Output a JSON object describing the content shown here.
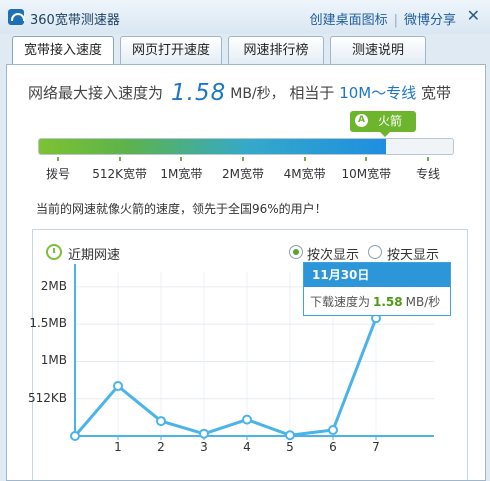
{
  "window": {
    "title": "360宽带测速器",
    "links": [
      "创建桌面图标",
      "微博分享"
    ]
  },
  "tabs": [
    {
      "label": "宽带接入速度",
      "active": true
    },
    {
      "label": "网页打开速度",
      "active": false
    },
    {
      "label": "网速排行榜",
      "active": false
    },
    {
      "label": "测速说明",
      "active": false
    }
  ],
  "result": {
    "prefix": "网络最大接入速度为",
    "speed": "1.58",
    "unit": "MB/秒，",
    "equiv_prefix": "相当于",
    "equiv_value": "10M～专线",
    "equiv_suffix": "宽带"
  },
  "meter": {
    "badge_label": "火箭",
    "badge_icon": "pin-icon",
    "fill_fraction": 0.838,
    "tick_labels": [
      "拨号",
      "512K宽带",
      "1M宽带",
      "2M宽带",
      "4M宽带",
      "10M宽带",
      "专线"
    ],
    "bar_colors": [
      "#7dc232",
      "#1f8ee0"
    ]
  },
  "description": "当前的网速就像火箭的速度，领先于全国96%的用户！",
  "recent": {
    "title": "近期网速",
    "radio_options": [
      {
        "label": "按次显示",
        "selected": true
      },
      {
        "label": "按天显示",
        "selected": false
      }
    ],
    "tooltip": {
      "date": "11月30日",
      "label": "下载速度为",
      "value": "1.58",
      "unit": "MB/秒"
    }
  },
  "chart_data": {
    "type": "line",
    "x": [
      0,
      1,
      2,
      3,
      4,
      5,
      6,
      7
    ],
    "x_tick_labels": [
      "1",
      "2",
      "3",
      "4",
      "5",
      "6",
      "7"
    ],
    "y_tick_labels": [
      "2MB",
      "1.5MB",
      "1MB",
      "512KB"
    ],
    "y_tick_values": [
      2,
      1.5,
      1,
      0.5
    ],
    "values": [
      0,
      0.67,
      0.2,
      0.03,
      0.22,
      0.01,
      0.08,
      1.58
    ],
    "ylim": [
      0,
      2.2
    ],
    "grid": true,
    "line_color": "#4ab3ea"
  }
}
